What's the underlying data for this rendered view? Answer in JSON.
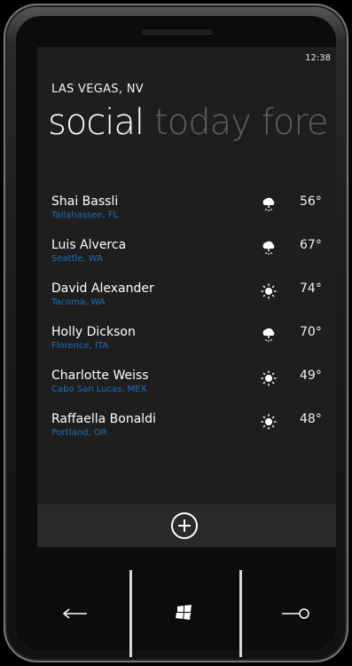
{
  "status_bar": {
    "time": "12:38"
  },
  "location": "LAS VEGAS, NV",
  "pivot": {
    "items": [
      "social",
      "today",
      "fore"
    ]
  },
  "people": [
    {
      "name": "Shai Bassli",
      "location": "Tallahassee, FL",
      "icon": "rain-cloud-icon",
      "temp": "56°"
    },
    {
      "name": "Luis Alverca",
      "location": "Seattle, WA",
      "icon": "rain-cloud-icon",
      "temp": "67°"
    },
    {
      "name": "David Alexander",
      "location": "Tacoma, WA",
      "icon": "sun-icon",
      "temp": "74°"
    },
    {
      "name": "Holly Dickson",
      "location": "Florence, ITA",
      "icon": "rain-cloud-icon",
      "temp": "70°"
    },
    {
      "name": "Charlotte Weiss",
      "location": "Cabo San Lucas, MEX",
      "icon": "sun-icon",
      "temp": "49°"
    },
    {
      "name": "Raffaella Bonaldi",
      "location": "Portland, OR",
      "icon": "sun-icon",
      "temp": "48°"
    }
  ],
  "appbar": {
    "add_icon": "add-icon"
  },
  "hardware_buttons": [
    "back-icon",
    "windows-logo-icon",
    "search-icon"
  ],
  "colors": {
    "accent": "#1f6fb8",
    "background": "#1e1e1e"
  }
}
